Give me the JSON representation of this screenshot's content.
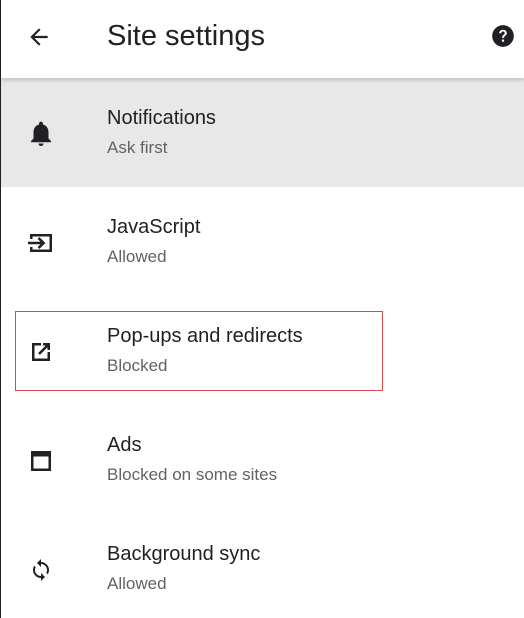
{
  "header": {
    "title": "Site settings",
    "back_icon": "arrow-back-icon",
    "help_icon": "help-icon"
  },
  "settings": [
    {
      "title": "Notifications",
      "subtitle": "Ask first",
      "icon": "bell-icon",
      "highlighted": true
    },
    {
      "title": "JavaScript",
      "subtitle": "Allowed",
      "icon": "javascript-icon",
      "highlighted": false
    },
    {
      "title": "Pop-ups and redirects",
      "subtitle": "Blocked",
      "icon": "open-in-new-icon",
      "highlighted": false,
      "focused": true
    },
    {
      "title": "Ads",
      "subtitle": "Blocked on some sites",
      "icon": "ads-window-icon",
      "highlighted": false
    },
    {
      "title": "Background sync",
      "subtitle": "Allowed",
      "icon": "sync-icon",
      "highlighted": false
    }
  ],
  "colors": {
    "highlight_row": "#e8e8e8",
    "focus_outline": "#e0474c",
    "text_primary": "#202124",
    "text_secondary": "#5f6368"
  }
}
